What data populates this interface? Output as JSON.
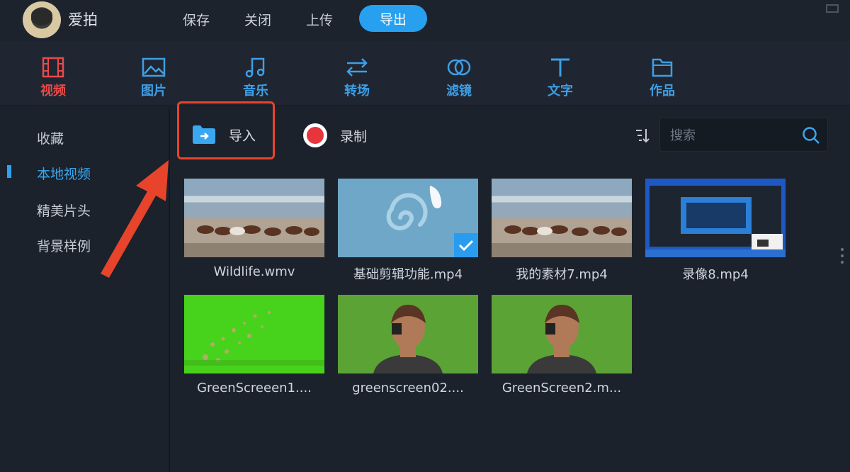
{
  "titlebar": {
    "app_name": "爱拍",
    "menu": {
      "save": "保存",
      "close": "关闭",
      "upload": "上传",
      "export": "导出"
    }
  },
  "toolbar": {
    "tools": [
      {
        "label": "视频",
        "icon": "film-icon",
        "active": true
      },
      {
        "label": "图片",
        "icon": "image-icon",
        "active": false
      },
      {
        "label": "音乐",
        "icon": "music-note-icon",
        "active": false
      },
      {
        "label": "转场",
        "icon": "transition-arrows-icon",
        "active": false
      },
      {
        "label": "滤镜",
        "icon": "filter-circles-icon",
        "active": false
      },
      {
        "label": "文字",
        "icon": "text-t-icon",
        "active": false
      },
      {
        "label": "作品",
        "icon": "folder-icon",
        "active": false
      }
    ]
  },
  "sidebar": {
    "items": [
      {
        "label": "收藏"
      },
      {
        "label": "本地视频",
        "active": true
      },
      {
        "label": "精美片头"
      },
      {
        "label": "背景样例"
      }
    ]
  },
  "actions": {
    "import_label": "导入",
    "record_label": "录制"
  },
  "search": {
    "placeholder": "搜索"
  },
  "media": [
    {
      "name": "Wildlife.wmv",
      "thumbnail": "horses"
    },
    {
      "name": "基础剪辑功能.mp4",
      "thumbnail": "swirl",
      "selected": true
    },
    {
      "name": "我的素材7.mp4",
      "thumbnail": "horses"
    },
    {
      "name": "录像8.mp4",
      "thumbnail": "screen-recording"
    },
    {
      "name": "GreenScreeen1....",
      "thumbnail": "green-particles"
    },
    {
      "name": "greenscreen02....",
      "thumbnail": "green-person"
    },
    {
      "name": "GreenScreen2.m...",
      "thumbnail": "green-person"
    }
  ],
  "colors": {
    "accent": "#27a0ef",
    "active_tool": "#e84a4a",
    "highlight_box": "#e8442b",
    "background": "#1b222c"
  }
}
